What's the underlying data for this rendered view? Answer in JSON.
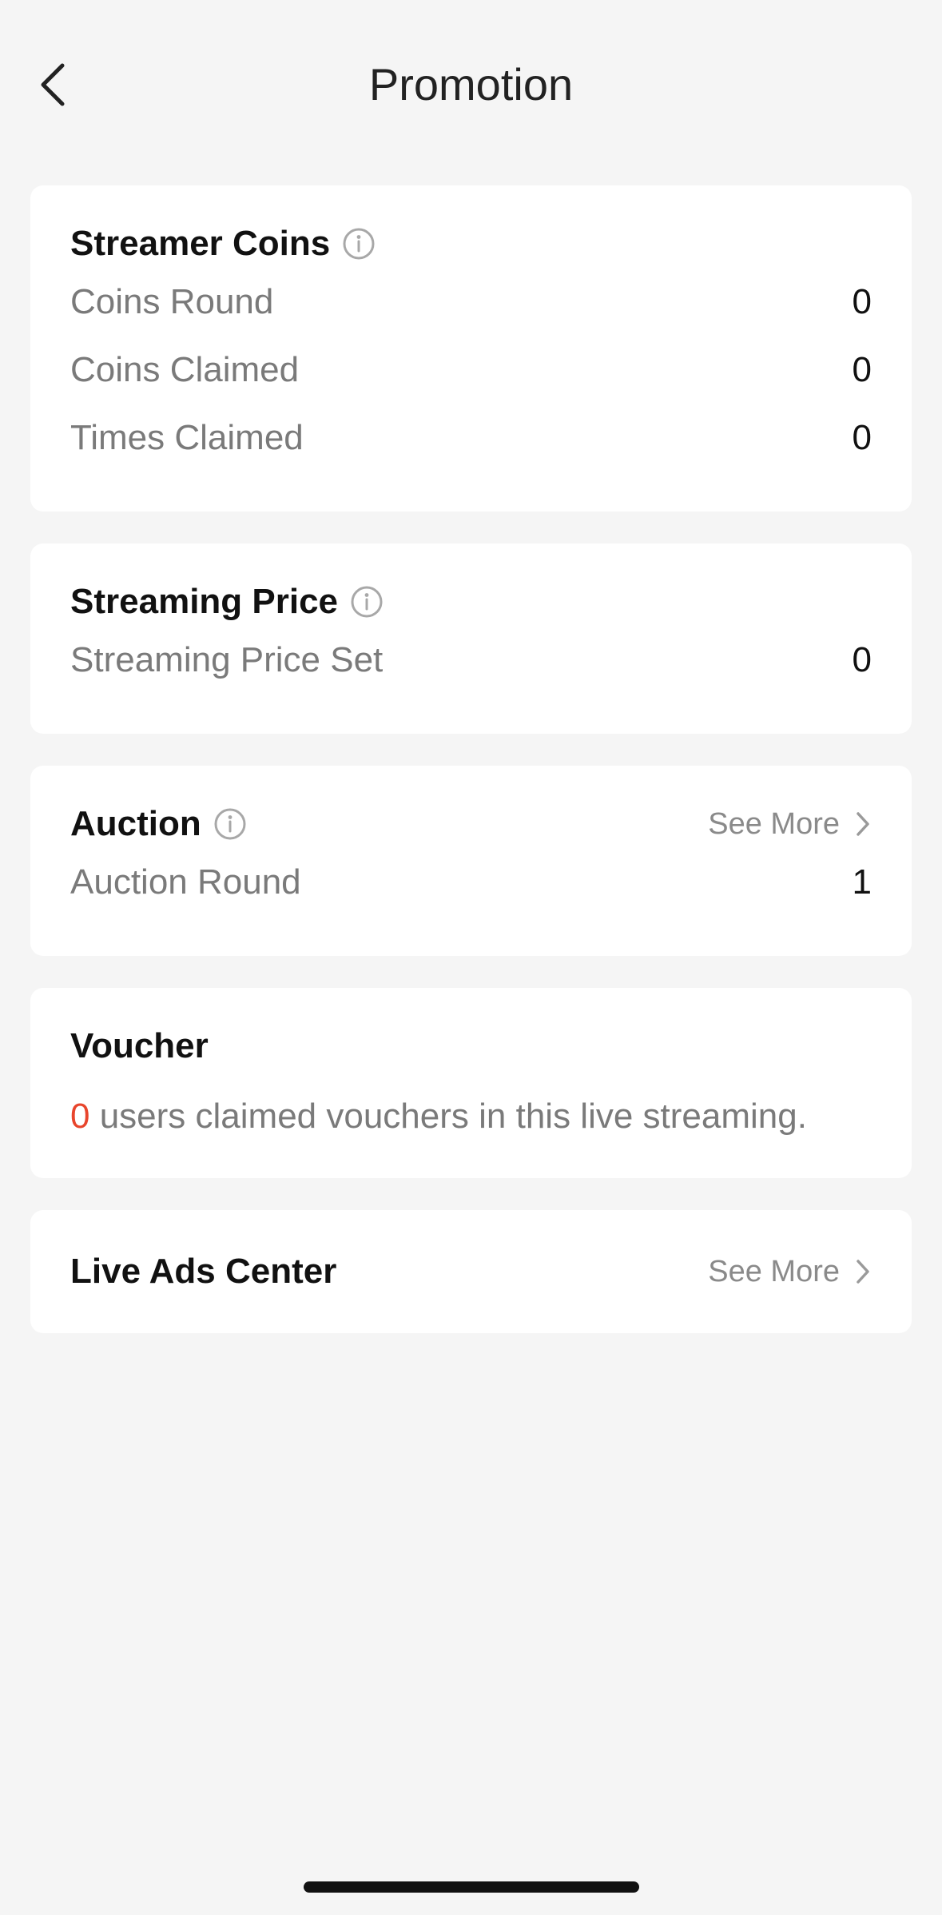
{
  "header": {
    "title": "Promotion",
    "back_icon": "chevron-left-icon"
  },
  "streamer_coins": {
    "title": "Streamer Coins",
    "info_icon": "info-icon",
    "rows": [
      {
        "label": "Coins Round",
        "value": "0"
      },
      {
        "label": "Coins Claimed",
        "value": "0"
      },
      {
        "label": "Times Claimed",
        "value": "0"
      }
    ]
  },
  "streaming_price": {
    "title": "Streaming Price",
    "info_icon": "info-icon",
    "rows": [
      {
        "label": "Streaming Price Set",
        "value": "0"
      }
    ]
  },
  "auction": {
    "title": "Auction",
    "info_icon": "info-icon",
    "see_more": "See More",
    "rows": [
      {
        "label": "Auction Round",
        "value": "1"
      }
    ]
  },
  "voucher": {
    "title": "Voucher",
    "count": "0",
    "text": " users claimed vouchers in this live streaming.",
    "count_color": "#e8452c"
  },
  "live_ads_center": {
    "title": "Live Ads Center",
    "see_more": "See More"
  }
}
